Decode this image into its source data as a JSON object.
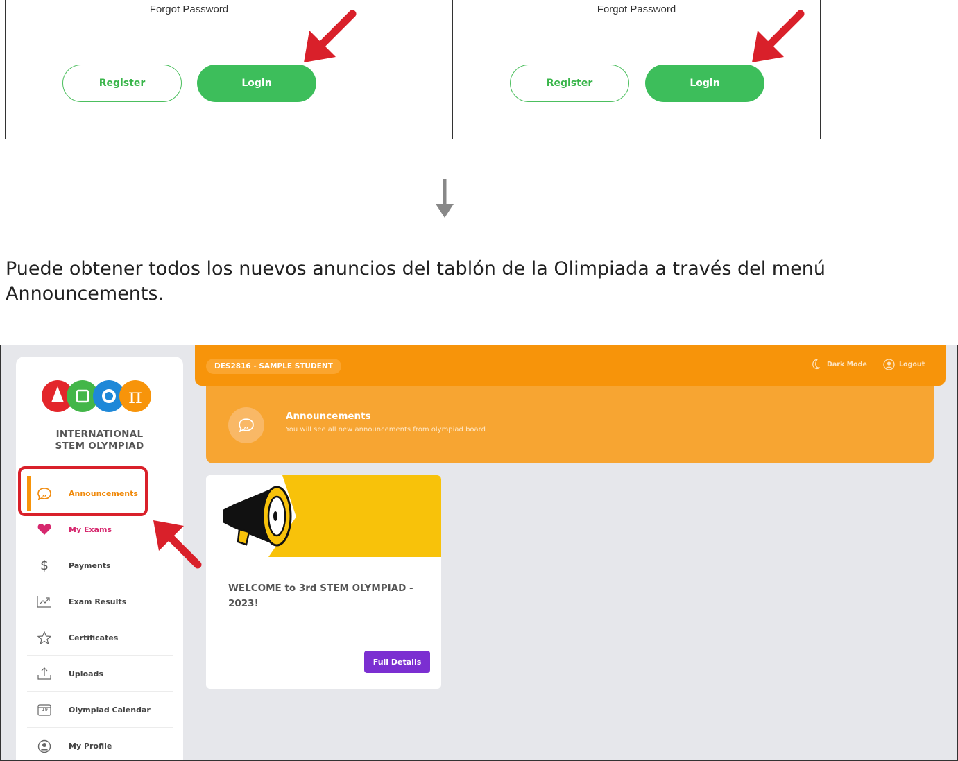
{
  "login_panels": [
    {
      "forgot_label": "Forgot Password",
      "register_label": "Register",
      "login_label": "Login"
    },
    {
      "forgot_label": "Forgot Password",
      "register_label": "Register",
      "login_label": "Login"
    }
  ],
  "instruction_text": "Puede obtener todos los nuevos anuncios del tablón de la Olimpiada a través del menú Announcements.",
  "app": {
    "brand": {
      "line1": "INTERNATIONAL",
      "line2": "STEM OLYMPIAD"
    },
    "header": {
      "student_label": "DES2816 - SAMPLE STUDENT",
      "dark_mode_label": "Dark Mode",
      "logout_label": "Logout"
    },
    "banner": {
      "title": "Announcements",
      "subtitle": "You will see all new announcements from olympiad board"
    },
    "sidebar": {
      "items": [
        {
          "label": "Announcements",
          "icon": "chat-quote-icon",
          "active": true
        },
        {
          "label": "My Exams",
          "icon": "heart-icon"
        },
        {
          "label": "Payments",
          "icon": "dollar-icon"
        },
        {
          "label": "Exam Results",
          "icon": "chart-icon"
        },
        {
          "label": "Certificates",
          "icon": "star-icon"
        },
        {
          "label": "Uploads",
          "icon": "upload-icon"
        },
        {
          "label": "Olympiad Calendar",
          "icon": "calendar-icon",
          "calendar_day": "19"
        },
        {
          "label": "My Profile",
          "icon": "user-icon"
        }
      ]
    },
    "announcement_card": {
      "title": "WELCOME to 3rd STEM OLYMPIAD - 2023!",
      "button_label": "Full Details"
    }
  },
  "colors": {
    "accent_orange": "#f7940a",
    "banner_orange": "#f7a532",
    "green": "#3dbe5b",
    "purple": "#7b2fd1",
    "highlight_red": "#d9202a",
    "active_text": "#f0890a",
    "exams_pink": "#d6286e"
  }
}
